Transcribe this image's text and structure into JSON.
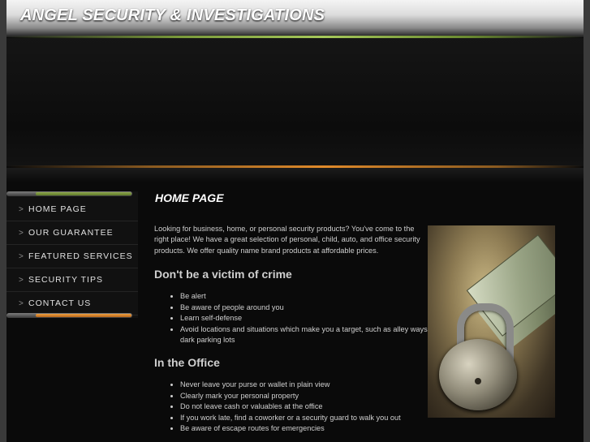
{
  "header": {
    "site_title": "ANGEL SECURITY & INVESTIGATIONS"
  },
  "nav": {
    "items": [
      {
        "label": "HOME PAGE",
        "icon": "chevron-right-icon"
      },
      {
        "label": "OUR GUARANTEE",
        "icon": "chevron-right-icon"
      },
      {
        "label": "FEATURED SERVICES",
        "icon": "chevron-right-icon"
      },
      {
        "label": "SECURITY TIPS",
        "icon": "chevron-right-icon"
      },
      {
        "label": "CONTACT US",
        "icon": "chevron-right-icon"
      }
    ],
    "chevron_glyph": ">"
  },
  "main": {
    "title": "HOME PAGE",
    "intro": "Looking for business, home, or personal security products? You've come to the right place! We have a great selection of personal, child, auto, and office security products. We offer quality name brand products at affordable prices.",
    "sections": [
      {
        "heading": "Don't be a victim of crime",
        "bullets": [
          "Be alert",
          "Be aware of people around you",
          "Learn self-defense",
          "Avoid locations and situations which make you a target, such as alley ways and dark parking lots"
        ]
      },
      {
        "heading": "In the Office",
        "bullets": [
          "Never leave your purse or wallet in plain view",
          "Clearly mark your personal property",
          "Do not leave cash or valuables at the office",
          "If you work late, find a coworker or a security guard to walk you out",
          "Be aware of escape routes for emergencies"
        ]
      }
    ]
  },
  "colors": {
    "accent_orange": "#e08a2a",
    "accent_green": "#a6c85a",
    "background": "#0a0a0a",
    "text": "#cfcfcf"
  }
}
